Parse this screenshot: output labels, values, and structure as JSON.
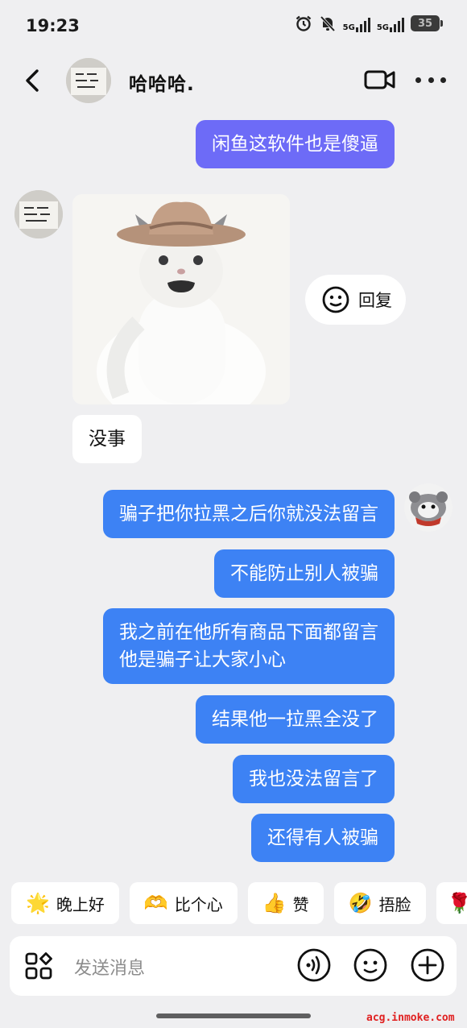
{
  "status_bar": {
    "time": "19:23",
    "battery": "35",
    "net1": "5G",
    "net2": "5G"
  },
  "header": {
    "contact_name": "哈哈哈."
  },
  "messages": [
    {
      "side": "right",
      "text": "闲鱼这软件也是傻逼"
    },
    {
      "side": "left",
      "type": "image",
      "description_icon": "cat-cowboy-hat-photo"
    },
    {
      "side": "left",
      "text": "没事"
    },
    {
      "side": "right",
      "text": "骗子把你拉黑之后你就没法留言"
    },
    {
      "side": "right",
      "text": "不能防止别人被骗"
    },
    {
      "side": "right",
      "text_line1": "我之前在他所有商品下面都留言",
      "text_line2": "他是骗子让大家小心"
    },
    {
      "side": "right",
      "text": "结果他一拉黑全没了"
    },
    {
      "side": "right",
      "text": "我也没法留言了"
    },
    {
      "side": "right",
      "text": "还得有人被骗"
    }
  ],
  "reply_chip": {
    "label": "回复"
  },
  "quick_replies": [
    {
      "emoji": "🌟",
      "label": "晚上好"
    },
    {
      "emoji": "🫶",
      "label": "比个心"
    },
    {
      "emoji": "👍",
      "label": "赞"
    },
    {
      "emoji": "🤣",
      "label": "捂脸"
    },
    {
      "emoji": "🌹",
      "label": ""
    }
  ],
  "input": {
    "placeholder": "发送消息"
  },
  "watermark": "acg.inmoke.com",
  "colors": {
    "bg": "#efeff1",
    "purple_bubble": "#6d6bf7",
    "blue_bubble": "#3d82f4",
    "white_bubble": "#ffffff"
  }
}
